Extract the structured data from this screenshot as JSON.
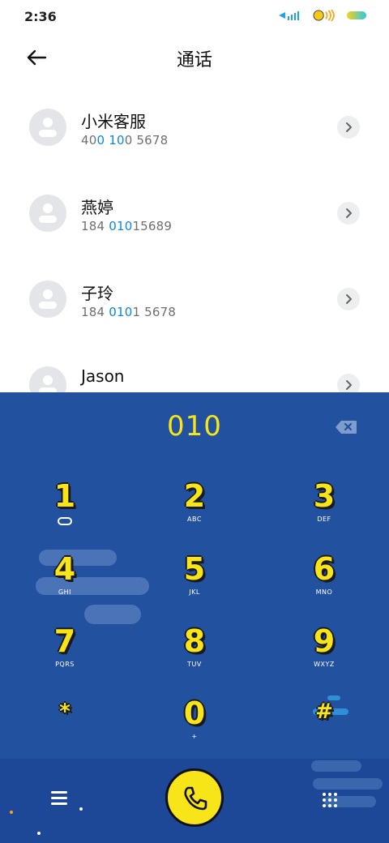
{
  "status_bar": {
    "time": "2:36"
  },
  "header": {
    "title": "通话"
  },
  "contacts": [
    {
      "name": "小米客服",
      "number_parts": [
        "40",
        "0",
        " ",
        "10",
        "0 5678"
      ]
    },
    {
      "name": "燕婷",
      "number_parts": [
        "184 ",
        "010",
        "15689",
        "",
        ""
      ]
    },
    {
      "name": "子玲",
      "number_parts": [
        "184 ",
        "010",
        "1 5678",
        "",
        ""
      ]
    },
    {
      "name": "Jason",
      "number_parts": [
        "",
        "",
        "",
        "",
        ""
      ]
    }
  ],
  "dialer": {
    "input": "010",
    "keys": [
      {
        "digit": "1",
        "letters": ""
      },
      {
        "digit": "2",
        "letters": "ABC"
      },
      {
        "digit": "3",
        "letters": "DEF"
      },
      {
        "digit": "4",
        "letters": "GHI"
      },
      {
        "digit": "5",
        "letters": "JKL"
      },
      {
        "digit": "6",
        "letters": "MNO"
      },
      {
        "digit": "7",
        "letters": "PQRS"
      },
      {
        "digit": "8",
        "letters": "TUV"
      },
      {
        "digit": "9",
        "letters": "WXYZ"
      },
      {
        "digit": "*",
        "letters": ""
      },
      {
        "digit": "0",
        "letters": "+"
      },
      {
        "digit": "#",
        "letters": ""
      }
    ]
  },
  "colors": {
    "accent_yellow": "#f7e51a",
    "dialer_blue": "#2251a0",
    "highlight_blue": "#0c88e0"
  }
}
